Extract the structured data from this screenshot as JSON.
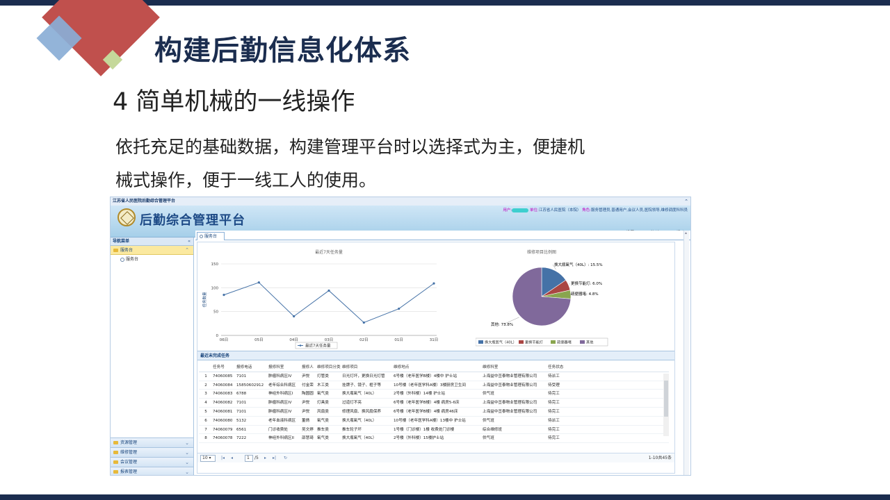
{
  "slide": {
    "title": "构建后勤信息化体系",
    "subtitle": "4  简单机械的一线操作",
    "para1": "依托充足的基础数据，构建管理平台时以选择式为主，便捷机",
    "para2": "械式操作，便于一线工人的使用。"
  },
  "colors": {
    "topbar": "#1b2d4f",
    "accent_red": "#c0504d",
    "accent_blue": "#8aaed6",
    "accent_green": "#c5d89a"
  },
  "app": {
    "window_title": "江苏省人民医院后勤综合管理平台",
    "name": "后勤综合管理平台",
    "user_key": "用户:",
    "unit_key": "单位:",
    "unit_value": "江苏省人民医院（本院）",
    "role_key": "角色:",
    "role_value": "服务管理员,普通用户,会议人员,医院领导,维修调度科科员",
    "menu": {
      "settings": "设置",
      "logout": "注销",
      "help": "帮助"
    },
    "nav": {
      "header": "导航菜单",
      "selected": "服务台",
      "sub_item": "服务台",
      "bottom_items": [
        "资源管理",
        "维修管理",
        "会议管理",
        "报表管理"
      ]
    },
    "tab": "服务台",
    "grid_title": "最近未完成任务",
    "pager": {
      "page_size": "10",
      "page": "1",
      "total_pages": "/5",
      "info": "1-10共45条"
    }
  },
  "chart_data": [
    {
      "type": "line",
      "title": "最近7天任务量",
      "ylabel": "任务数量",
      "categories": [
        "06日",
        "05日",
        "04日",
        "03日",
        "02日",
        "01日",
        "31日"
      ],
      "series": [
        {
          "name": "最近7天任务量",
          "values": [
            85,
            111,
            40,
            94,
            27,
            56,
            109
          ]
        }
      ],
      "ylim": [
        0,
        150
      ],
      "yticks": [
        "0",
        "50",
        "100",
        "150"
      ],
      "grid": true,
      "legend": "bottom"
    },
    {
      "type": "pie",
      "title": "维修项目比例图",
      "slices": [
        {
          "name": "换大瓶氧气（40L）",
          "value": 15.5,
          "label": "换大瓶氧气（40L）: 15.5%",
          "color": "#4572a7"
        },
        {
          "name": "更换节能灯",
          "value": 6.0,
          "label": "更换节能灯: 6.0%",
          "color": "#aa4643"
        },
        {
          "name": "疏便器堵",
          "value": 4.8,
          "label": "疏便器堵: 4.8%",
          "color": "#89a54e"
        },
        {
          "name": "其他",
          "value": 73.8,
          "label": "其他: 73.8%",
          "color": "#80699b"
        }
      ],
      "legend_entries": [
        "换大瓶氧气（40L）",
        "更换节能灯",
        "疏便器堵",
        "其他"
      ],
      "legend": "bottom"
    }
  ],
  "table": {
    "headers": [
      "",
      "任务号",
      "报修电话",
      "报修科室",
      "报修人",
      "维修项目分类",
      "维修项目",
      "维修地点",
      "维修科室",
      "任务状态"
    ],
    "rows": [
      [
        "1",
        "74060085",
        "7101",
        "肿瘤科病区IV",
        "尹悦",
        "灯管类",
        "日光灯坏，更换日光灯管",
        "6号楼（老年医学B楼）4楼中 护士站",
        "上海益中亘泰物业管理有限公司",
        "待派工"
      ],
      [
        "2",
        "74060084",
        "15850602912",
        "老年综合科病区",
        "付金荣",
        "木工类",
        "挂牌子、镜子、框子等",
        "10号楼（老年医学科A楼）3楼厨房卫生间",
        "上海益中亘泰物业管理有限公司",
        "待受理"
      ],
      [
        "3",
        "74060083",
        "6788",
        "神经外科病区I",
        "陶圆圆",
        "氧气类",
        "换大瓶氧气（40L）",
        "2号楼（外科楼）14楼 护士站",
        "供气班",
        "待完工"
      ],
      [
        "4",
        "74060082",
        "7101",
        "肿瘤科病区IV",
        "尹悦",
        "灯具类",
        "过道灯不亮",
        "6号楼（老年医学B楼）4楼 病房5-6床",
        "上海益中亘泰物业管理有限公司",
        "待完工"
      ],
      [
        "5",
        "74060081",
        "7101",
        "肿瘤科病区IV",
        "尹悦",
        "风扇类",
        "修理风扇、换风扇保养",
        "6号楼（老年医学B楼）4楼 病房46床",
        "上海益中亘泰物业管理有限公司",
        "待完工"
      ],
      [
        "6",
        "74060080",
        "5132",
        "老年血液科病区",
        "董倩",
        "氧气类",
        "换大瓶氧气（40L）",
        "10号楼（老年医学科A楼）13楼中 护士站",
        "供气班",
        "待派工"
      ],
      [
        "7",
        "74060079",
        "6561",
        "门诊收费处",
        "吴文婷",
        "推车类",
        "推车轮子坏",
        "1号楼（门诊楼）1楼 收费处门诊楼",
        "综合维修班",
        "待完工"
      ],
      [
        "8",
        "74060078",
        "7222",
        "神经外科病区II",
        "邵慧琦",
        "氧气类",
        "换大瓶氧气（40L）",
        "2号楼（外科楼）15楼护士站",
        "供气班",
        "待完工"
      ]
    ]
  }
}
